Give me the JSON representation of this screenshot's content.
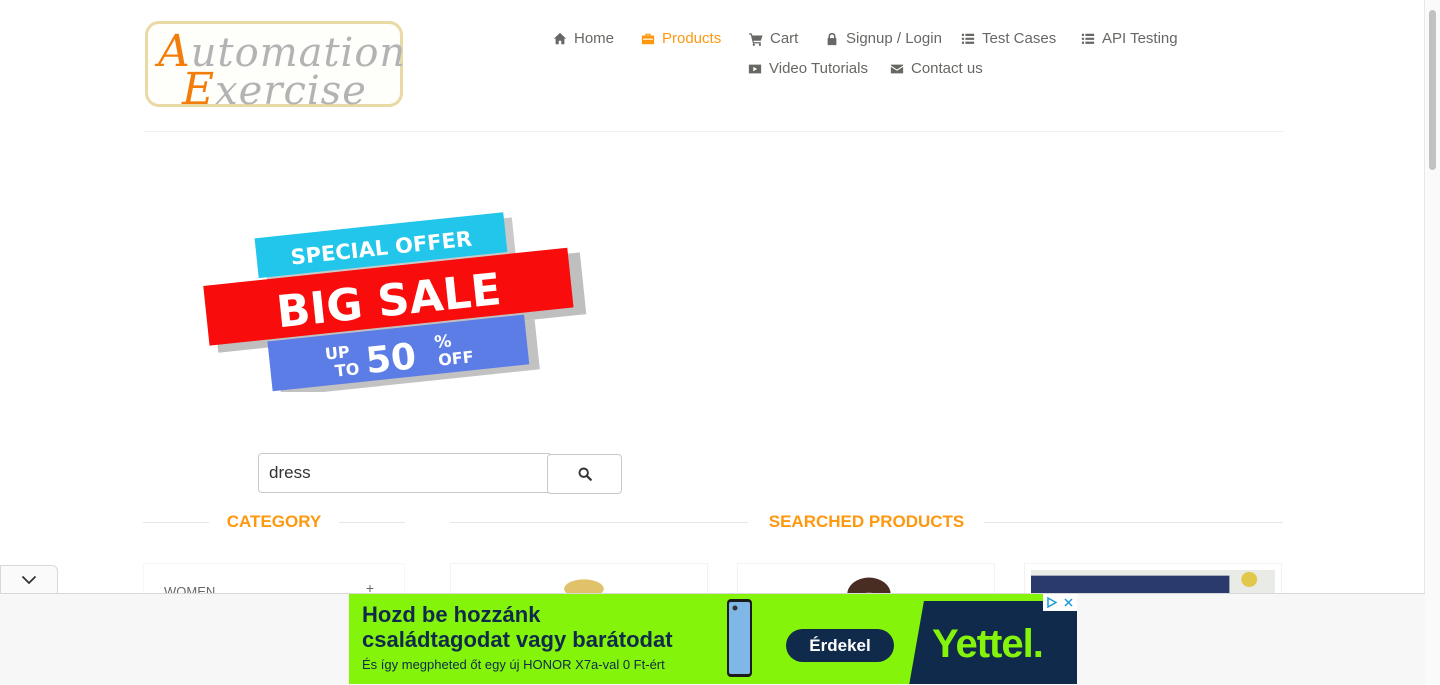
{
  "logo": {
    "line1_cap": "A",
    "line1_rest": "utomation",
    "line2_cap": "E",
    "line2_rest": "xercise"
  },
  "nav": {
    "items": [
      {
        "label": "Home",
        "icon": "home-icon"
      },
      {
        "label": "Products",
        "icon": "products-icon",
        "active": true
      },
      {
        "label": "Cart",
        "icon": "cart-icon"
      },
      {
        "label": "Signup / Login",
        "icon": "lock-icon"
      },
      {
        "label": "Test Cases",
        "icon": "list-icon"
      },
      {
        "label": "API Testing",
        "icon": "list-icon"
      },
      {
        "label": "Video Tutorials",
        "icon": "youtube-icon"
      },
      {
        "label": "Contact us",
        "icon": "envelope-icon"
      }
    ]
  },
  "banner": {
    "special_offer": "SPECIAL OFFER",
    "big_sale": "BIG SALE",
    "up": "UP",
    "to": "TO",
    "percent_value": "50",
    "percent_sign": "%",
    "off": "OFF"
  },
  "search": {
    "value": "dress",
    "icon": "search-icon"
  },
  "sections": {
    "category": "CATEGORY",
    "searched_products": "SEARCHED PRODUCTS"
  },
  "category": {
    "first_item": "WOMEN",
    "expand": "+"
  },
  "ad": {
    "headline_1": "Hozd be hozzánk",
    "headline_2": "családtagodat vagy barátodat",
    "subline": "És így megpheted őt egy új HONOR X7a-val 0 Ft-ért",
    "cta": "Érdekel",
    "brand": "Yettel."
  },
  "colors": {
    "accent": "#fe980f",
    "text": "#696763",
    "ad_bg": "#84f50a",
    "ad_navy": "#0f2a4a"
  }
}
